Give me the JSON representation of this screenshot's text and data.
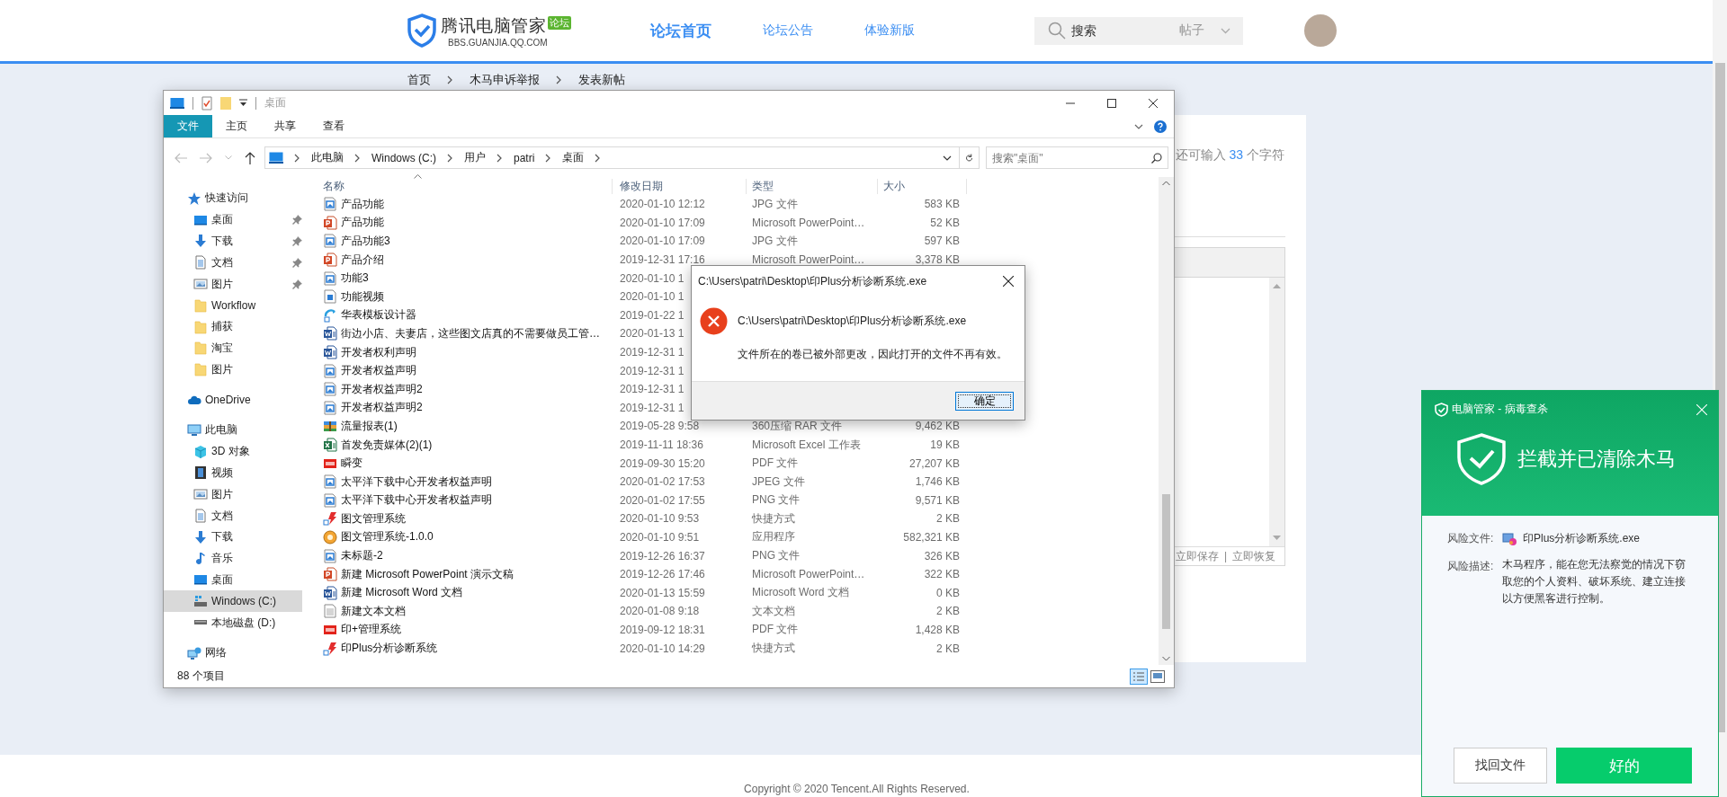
{
  "site_header": {
    "logo_title": "腾讯电脑管家",
    "logo_badge": "论坛",
    "logo_url": "BBS.GUANJIA.QQ.COM",
    "nav": [
      {
        "label": "论坛首页",
        "selected": true
      },
      {
        "label": "论坛公告",
        "selected": false
      },
      {
        "label": "体验新版",
        "selected": false
      }
    ],
    "search": {
      "placeholder": "搜索",
      "scope": "帖子"
    }
  },
  "breadcrumb": [
    "首页",
    "木马申诉举报",
    "发表新帖"
  ],
  "post_form": {
    "char_count_prefix": "还可输入",
    "char_count": "33",
    "char_count_suffix": "个字符",
    "editor_actions": [
      "立即保存",
      "立即恢复"
    ],
    "editor_action_separator": "|"
  },
  "explorer": {
    "title": "桌面",
    "ribbon_tabs": [
      {
        "label": "文件",
        "selected": true
      },
      {
        "label": "主页",
        "selected": false
      },
      {
        "label": "共享",
        "selected": false
      },
      {
        "label": "查看",
        "selected": false
      }
    ],
    "address_path": [
      "此电脑",
      "Windows (C:)",
      "用户",
      "patri",
      "桌面"
    ],
    "search": {
      "placeholder": "搜索\"桌面\""
    },
    "nav_pane": [
      {
        "label": "快速访问",
        "kind": "star",
        "selected": false,
        "children": [
          {
            "label": "桌面",
            "kind": "desktop",
            "pinned": true,
            "selected": false
          },
          {
            "label": "下载",
            "kind": "download",
            "pinned": true,
            "selected": false
          },
          {
            "label": "文档",
            "kind": "document",
            "pinned": true,
            "selected": false
          },
          {
            "label": "图片",
            "kind": "pictures",
            "pinned": true,
            "selected": false
          },
          {
            "label": "Workflow",
            "kind": "folder",
            "pinned": false,
            "selected": false
          },
          {
            "label": "捕获",
            "kind": "folder",
            "pinned": false,
            "selected": false
          },
          {
            "label": "淘宝",
            "kind": "folder",
            "pinned": false,
            "selected": false
          },
          {
            "label": "图片",
            "kind": "folder",
            "pinned": false,
            "selected": false
          }
        ]
      },
      {
        "label": "OneDrive",
        "kind": "cloud",
        "selected": false
      },
      {
        "label": "此电脑",
        "kind": "pc",
        "selected": false,
        "children": [
          {
            "label": "3D 对象",
            "kind": "cube",
            "selected": false
          },
          {
            "label": "视频",
            "kind": "video",
            "selected": false
          },
          {
            "label": "图片",
            "kind": "pictures",
            "selected": false
          },
          {
            "label": "文档",
            "kind": "document",
            "selected": false
          },
          {
            "label": "下载",
            "kind": "download",
            "selected": false
          },
          {
            "label": "音乐",
            "kind": "music",
            "selected": false
          },
          {
            "label": "桌面",
            "kind": "desktop",
            "selected": false
          },
          {
            "label": "Windows (C:)",
            "kind": "system-drive",
            "selected": true
          },
          {
            "label": "本地磁盘 (D:)",
            "kind": "drive",
            "selected": false
          }
        ]
      },
      {
        "label": "网络",
        "kind": "network",
        "selected": false
      }
    ],
    "columns": [
      "名称",
      "修改日期",
      "类型",
      "大小"
    ],
    "files": [
      {
        "name": "产品功能",
        "date": "2020-01-10 12:12",
        "type": "JPG 文件",
        "size": "583 KB",
        "kind": "image"
      },
      {
        "name": "产品功能",
        "date": "2020-01-10 17:09",
        "type": "Microsoft PowerPoint…",
        "size": "52 KB",
        "kind": "ppt"
      },
      {
        "name": "产品功能3",
        "date": "2020-01-10 17:09",
        "type": "JPG 文件",
        "size": "597 KB",
        "kind": "image"
      },
      {
        "name": "产品介绍",
        "date": "2019-12-31 17:16",
        "type": "Microsoft PowerPoint…",
        "size": "3,378 KB",
        "kind": "ppt"
      },
      {
        "name": "功能3",
        "date": "2020-01-10 1",
        "kind": "image"
      },
      {
        "name": "功能视频",
        "date": "2020-01-10 1",
        "kind": "video"
      },
      {
        "name": "华表模板设计器",
        "date": "2019-01-22 1",
        "kind": "designer"
      },
      {
        "name": "街边小店、夫妻店，这些图文店真的不需要做员工管…",
        "date": "2020-01-13 1",
        "kind": "word"
      },
      {
        "name": "开发者权利声明",
        "date": "2019-12-31 1",
        "kind": "word"
      },
      {
        "name": "开发者权益声明",
        "date": "2019-12-31 1",
        "kind": "image"
      },
      {
        "name": "开发者权益声明2",
        "date": "2019-12-31 1",
        "kind": "image"
      },
      {
        "name": "开发者权益声明2",
        "date": "2019-12-31 1",
        "kind": "image"
      },
      {
        "name": "流量报表(1)",
        "date": "2019-05-28 9:58",
        "type": "360压缩 RAR 文件",
        "size": "9,462 KB",
        "kind": "archive"
      },
      {
        "name": "首发免责媒体(2)(1)",
        "date": "2019-11-11 18:36",
        "type": "Microsoft Excel 工作表",
        "size": "19 KB",
        "kind": "excel"
      },
      {
        "name": "瞬变",
        "date": "2019-09-30 15:20",
        "type": "PDF 文件",
        "size": "27,207 KB",
        "kind": "pdf"
      },
      {
        "name": "太平洋下载中心开发者权益声明",
        "date": "2020-01-02 17:53",
        "type": "JPEG 文件",
        "size": "1,746 KB",
        "kind": "image"
      },
      {
        "name": "太平洋下载中心开发者权益声明",
        "date": "2020-01-02 17:55",
        "type": "PNG 文件",
        "size": "9,571 KB",
        "kind": "image"
      },
      {
        "name": "图文管理系统",
        "date": "2020-01-10 9:53",
        "type": "快捷方式",
        "size": "2 KB",
        "kind": "shortcut"
      },
      {
        "name": "图文管理系统-1.0.0",
        "date": "2020-01-10 9:51",
        "type": "应用程序",
        "size": "582,321 KB",
        "kind": "setup"
      },
      {
        "name": "未标题-2",
        "date": "2019-12-26 16:37",
        "type": "PNG 文件",
        "size": "326 KB",
        "kind": "image"
      },
      {
        "name": "新建 Microsoft PowerPoint 演示文稿",
        "date": "2019-12-26 17:46",
        "type": "Microsoft PowerPoint…",
        "size": "322 KB",
        "kind": "ppt"
      },
      {
        "name": "新建 Microsoft Word 文档",
        "date": "2020-01-13 15:59",
        "type": "Microsoft Word 文档",
        "size": "0 KB",
        "kind": "word"
      },
      {
        "name": "新建文本文档",
        "date": "2020-01-08 9:18",
        "type": "文本文档",
        "size": "2 KB",
        "kind": "text"
      },
      {
        "name": "印+管理系统",
        "date": "2019-09-12 18:31",
        "type": "PDF 文件",
        "size": "1,428 KB",
        "kind": "pdf"
      },
      {
        "name": "印Plus分析诊断系统",
        "date": "2020-01-10 14:29",
        "type": "快捷方式",
        "size": "2 KB",
        "kind": "shortcut"
      }
    ],
    "status": "88 个项目"
  },
  "dialog": {
    "title": "C:\\Users\\patri\\Desktop\\印Plus分析诊断系统.exe",
    "path": "C:\\Users\\patri\\Desktop\\印Plus分析诊断系统.exe",
    "message": "文件所在的卷已被外部更改，因此打开的文件不再有效。",
    "button": "确定"
  },
  "popup": {
    "title": "电脑管家 - 病毒查杀",
    "headline": "拦截并已清除木马",
    "fields": [
      {
        "label": "风险文件:",
        "value": "印Plus分析诊断系统.exe",
        "kind": "file"
      },
      {
        "label": "风险描述:",
        "value": "木马程序，能在您无法察觉的情况下窃取您的个人资料、破坏系统、建立连接以方便黑客进行控制。",
        "kind": "text"
      }
    ],
    "buttons": [
      {
        "label": "找回文件",
        "kind": "secondary"
      },
      {
        "label": "好的",
        "kind": "primary"
      }
    ]
  },
  "footer": {
    "copyright": "Copyright © 2020 Tencent.All Rights Reserved."
  }
}
